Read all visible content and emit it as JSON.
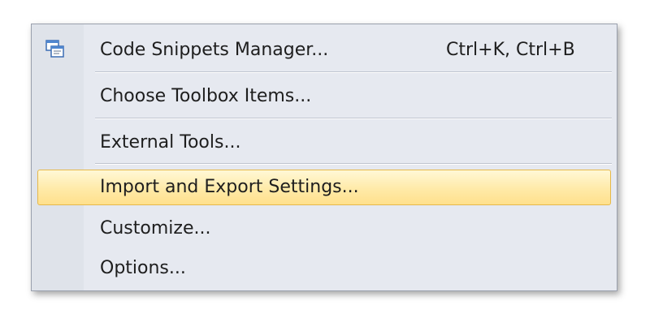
{
  "menu": {
    "items": [
      {
        "label": "Code Snippets Manager...",
        "shortcut": "Ctrl+K, Ctrl+B",
        "icon": "code-snippets-icon"
      },
      {
        "label": "Choose Toolbox Items..."
      },
      {
        "label": "External Tools..."
      },
      {
        "label": "Import and Export Settings...",
        "highlighted": true
      },
      {
        "label": "Customize..."
      },
      {
        "label": "Options..."
      }
    ]
  },
  "colors": {
    "menu_background": "#e6e9f0",
    "gutter": "#dfe3ea",
    "highlight_border": "#e6b84a",
    "highlight_fill": "#ffeaa8"
  }
}
